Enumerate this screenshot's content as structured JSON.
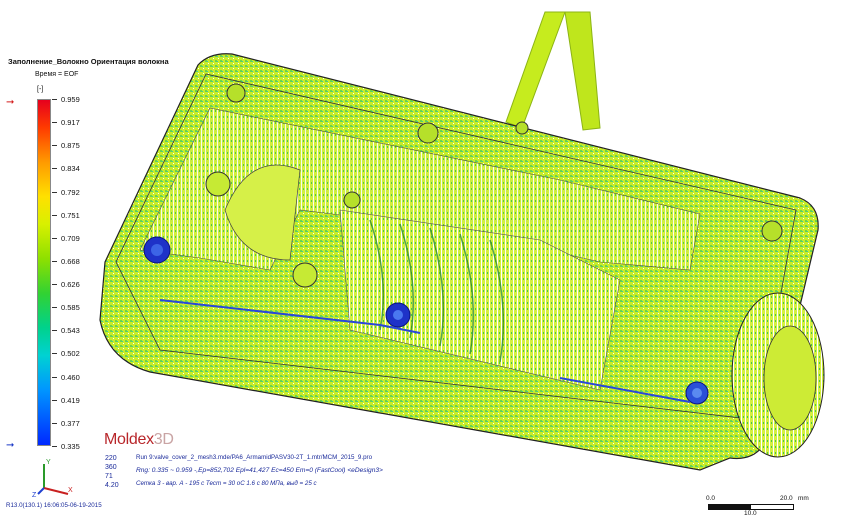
{
  "legend": {
    "title": "Заполнение_Волокно Ориентация волокна",
    "time": "Время = EOF",
    "unit": "[-]",
    "values": [
      "0.959",
      "0.917",
      "0.875",
      "0.834",
      "0.792",
      "0.751",
      "0.709",
      "0.668",
      "0.626",
      "0.585",
      "0.543",
      "0.502",
      "0.460",
      "0.419",
      "0.377",
      "0.335"
    ],
    "max_marker_color": "#d42020",
    "min_marker_color": "#1e3cc8"
  },
  "brand": {
    "name": "Moldex",
    "suffix": "3D"
  },
  "stats": [
    "220",
    "360",
    "71",
    "4.20"
  ],
  "run_info": {
    "run_line": "Run 9:valve_cover_2_mesh3.mde/PA6_ArmamidPASV30-2T_1.mtr/MCM_2015_9.pro",
    "range_line": "Rng: 0.335 ~ 0.959 -,Ep=852,702 Epl=41,427 Ec=450 Em=0 (FastCool) <eDesign3>",
    "cell_line": "Сетка 3 - вар. А - 195 с Тест = 30 оС 1.6 с 80 МПа, выд = 25 с"
  },
  "footer": "R13.0(130.1) 16:06:05-06-19-2015",
  "scalebar": {
    "start": "0.0",
    "end": "20.0",
    "unit": "mm",
    "mid": "10.0"
  },
  "triad": {
    "x": "X",
    "y": "Y",
    "z": "Z"
  }
}
